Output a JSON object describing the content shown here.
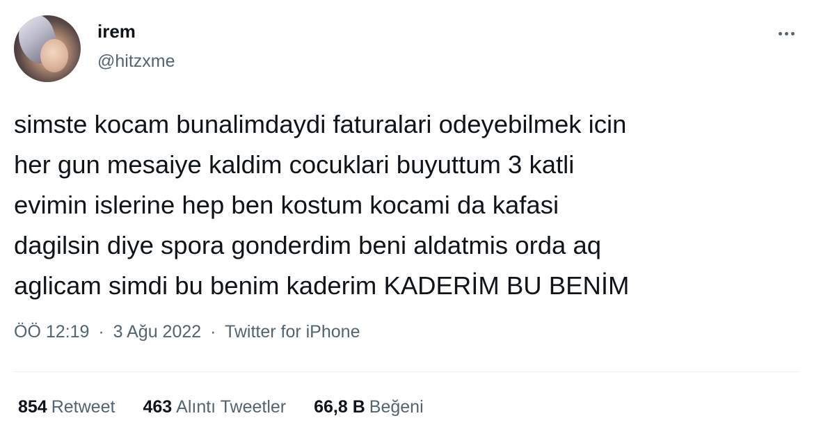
{
  "user": {
    "name": "irem",
    "handle": "@hitzxme"
  },
  "tweet": {
    "lines": [
      "simste kocam bunalimdaydi faturalari odeyebilmek icin",
      "her gun mesaiye kaldim cocuklari buyuttum 3 katli",
      "evimin islerine hep ben kostum kocami da kafasi",
      "dagilsin diye spora gonderdim beni aldatmis orda aq",
      "aglicam simdi bu benim kaderim KADERİM BU BENİM"
    ],
    "time": "ÖÖ 12:19",
    "date": "3 Ağu 2022",
    "source": "Twitter for iPhone",
    "separator": "·"
  },
  "stats": {
    "retweets": {
      "count": "854",
      "label": "Retweet"
    },
    "quotes": {
      "count": "463",
      "label": "Alıntı Tweetler"
    },
    "likes": {
      "count": "66,8 B",
      "label": "Beğeni"
    }
  },
  "icons": {
    "more": "more-horizontal-icon"
  },
  "colors": {
    "text": "#0f1419",
    "secondary": "#536471",
    "divider": "#eff3f4"
  }
}
